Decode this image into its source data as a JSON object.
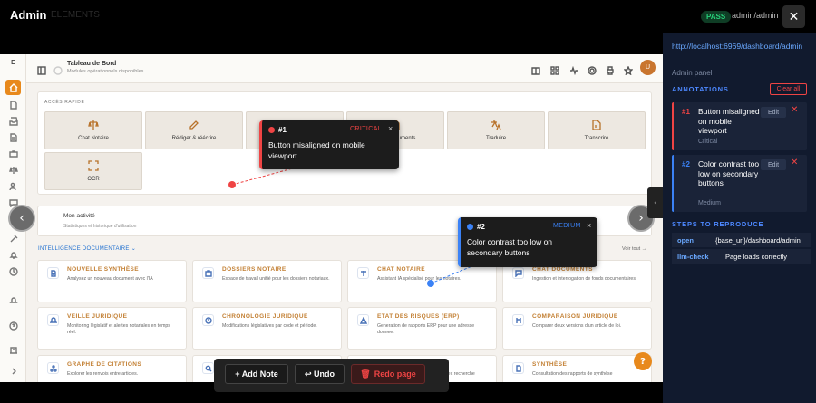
{
  "topbar": {
    "title": "Admin",
    "subtitle": "ELEMENTS",
    "status": "PASS",
    "user": "admin/admin",
    "close_icon": "close-icon"
  },
  "app": {
    "sidebar": {
      "logo": "E",
      "icons": [
        "home-icon",
        "document-icon",
        "inbox-icon",
        "file-icon",
        "briefcase-icon",
        "scale-icon",
        "users-icon",
        "chat-icon",
        "edit-icon",
        "tools-icon",
        "bell-icon",
        "clock-icon",
        "notification-icon",
        "help-icon",
        "building-icon",
        "chevron-right-icon"
      ]
    },
    "header": {
      "title": "Tableau de Bord",
      "subtitle": "Modules opérationnels disponibles",
      "avatar": "U"
    },
    "quick_access": {
      "label": "ACCÈS RAPIDE",
      "items": [
        {
          "label": "Chat Notaire",
          "icon": "scale-icon"
        },
        {
          "label": "Rédiger & réécrire",
          "icon": "pen-icon"
        },
        {
          "label": "",
          "icon": "folder-icon"
        },
        {
          "label": "...uments",
          "icon": "document-icon"
        },
        {
          "label": "Traduire",
          "icon": "translate-icon"
        },
        {
          "label": "Transcrire",
          "icon": "transcribe-icon"
        },
        {
          "label": "OCR",
          "icon": "scan-icon"
        }
      ]
    },
    "activity": {
      "title": "Mon activité",
      "subtitle": "Statistiques et historique d'utilisation"
    },
    "intel": {
      "label": "INTELLIGENCE DOCUMENTAIRE",
      "see_all": "Voir tout →"
    },
    "modules": [
      {
        "title": "NOUVELLE SYNTHÈSE",
        "desc": "Analysez un nouveau document avec l'IA",
        "icon": "document-plus-icon"
      },
      {
        "title": "DOSSIERS NOTAIRE",
        "desc": "Espace de travail unifié pour les dossiers notariaux.",
        "icon": "briefcase-icon"
      },
      {
        "title": "CHAT NOTAIRE",
        "desc": "Assistant IA spécialisé pour les notaires.",
        "icon": "scale-icon"
      },
      {
        "title": "CHAT DOCUMENTS",
        "desc": "Ingestion et interrogation de fonds documentaires.",
        "icon": "chat-icon"
      },
      {
        "title": "VEILLE JURIDIQUE",
        "desc": "Monitoring législatif et alertes notariales en temps réel.",
        "icon": "bell-icon"
      },
      {
        "title": "CHRONOLOGIE JURIDIQUE",
        "desc": "Modifications législatives par code et période.",
        "icon": "clock-icon"
      },
      {
        "title": "ETAT DES RISQUES (ERP)",
        "desc": "Generation de rapports ERP pour une adresse donnee.",
        "icon": "warning-icon"
      },
      {
        "title": "COMPARAISON JURIDIQUE",
        "desc": "Comparer deux versions d'un article de loi.",
        "icon": "compare-icon"
      },
      {
        "title": "GRAPHE DE CITATIONS",
        "desc": "Explorer les renvois entre articles.",
        "icon": "graph-icon"
      },
      {
        "title": "",
        "desc": "",
        "icon": "search-icon"
      },
      {
        "title": "",
        "desc": "...avec recherche",
        "icon": "book-icon"
      },
      {
        "title": "SYNTHÈSE",
        "desc": "Consultation des rapports de synthèse",
        "icon": "file-icon"
      }
    ]
  },
  "tooltips": [
    {
      "num": "#1",
      "severity": "CRITICAL",
      "text": "Button misaligned on mobile viewport",
      "color": "#ef4444"
    },
    {
      "num": "#2",
      "severity": "MEDIUM",
      "text": "Color contrast too low on secondary buttons",
      "color": "#3b82f6"
    }
  ],
  "toolbar": {
    "add": "+ Add Note",
    "undo": "↩ Undo",
    "redo": "Redo page"
  },
  "panel": {
    "url": "http://localhost:6969/dashboard/admin",
    "admin_label": "Admin panel",
    "annotations_heading": "ANNOTATIONS",
    "clear_all": "Clear all",
    "annotations": [
      {
        "num": "#1",
        "text": "Button misaligned on mobile viewport",
        "severity": "Critical",
        "color": "#ef4444",
        "edit": "Edit"
      },
      {
        "num": "#2",
        "text": "Color contrast too low on secondary buttons",
        "severity": "Medium",
        "color": "#3b82f6",
        "edit": "Edit"
      }
    ],
    "steps_heading": "STEPS TO REPRODUCE",
    "steps": [
      {
        "key": "open",
        "value": "{base_url}/dashboard/admin"
      },
      {
        "key": "llm-check",
        "value": "Page loads correctly"
      }
    ]
  }
}
